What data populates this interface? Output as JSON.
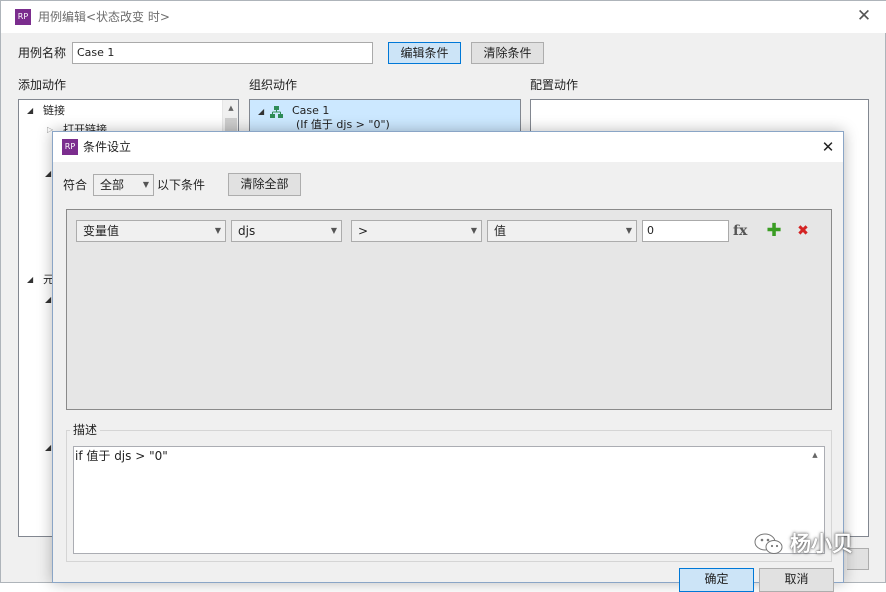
{
  "outer_window": {
    "icon_text": "RP",
    "title": "用例编辑<状态改变 时>",
    "close_glyph": "✕",
    "case_name_label": "用例名称",
    "case_name_value": "Case 1",
    "edit_condition_button": "编辑条件",
    "clear_condition_button": "清除条件",
    "add_action_header": "添加动作",
    "organize_action_header": "组织动作",
    "configure_action_header": "配置动作",
    "add_action_tree": {
      "link_group": "链接",
      "open_link": "打开链接",
      "element_group_partial": "元"
    },
    "organize_tree": {
      "case_label": "Case 1",
      "case_condition": "(If 值于 djs > \"0\")"
    }
  },
  "dialog": {
    "icon_text": "RP",
    "title": "条件设立",
    "close_glyph": "✕",
    "match_label": "符合",
    "match_value": "全部",
    "match_suffix": "以下条件",
    "clear_all_button": "清除全部",
    "condition_row": {
      "type": "变量值",
      "variable": "djs",
      "operator": ">",
      "value_type": "值",
      "value": "0",
      "fx_label": "fx",
      "add_glyph": "✚",
      "remove_glyph": "✖"
    },
    "description_label": "描述",
    "description_text": "if 值于 djs > \"0\"",
    "ok_button": "确定",
    "cancel_button": "取消"
  },
  "watermark": {
    "text": "杨小贝"
  }
}
